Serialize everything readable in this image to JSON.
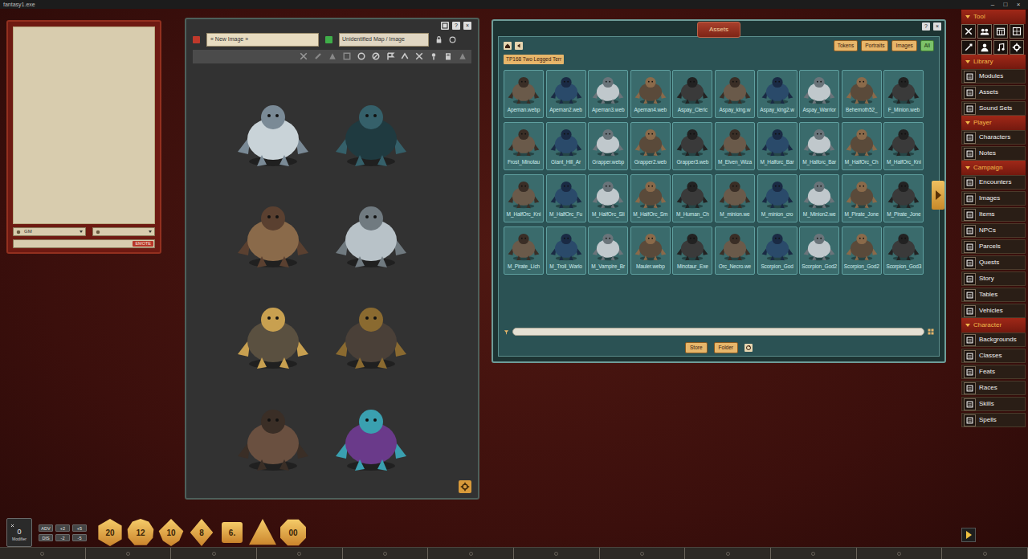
{
  "app": {
    "title": "fantasy1.exe",
    "controls": [
      "–",
      "□",
      "×"
    ]
  },
  "chat": {
    "speaker": "GM",
    "button": "EMOTE"
  },
  "image_window": {
    "name": "« New Image »",
    "type": "Unidentified Map / Image",
    "help": "?",
    "close": "×"
  },
  "assets": {
    "title": "Assets",
    "help": "?",
    "close": "×",
    "filters": [
      {
        "label": "Tokens",
        "selected": false
      },
      {
        "label": "Portraits",
        "selected": false
      },
      {
        "label": "Images",
        "selected": false
      },
      {
        "label": "All",
        "selected": true
      }
    ],
    "path": "TP168 Two Legged Terr",
    "items": [
      "Apeman.webp",
      "Apeman2.web",
      "Apeman3.web",
      "Apeman4.web",
      "Aspay_Cleric",
      "Aspay_king.w",
      "Aspay_king2.w",
      "Aspay_Warrior",
      "Behemoth52_",
      "F_Minion.web",
      "Frost_Minotau",
      "Giant_Hill_Ar",
      "Grapper.webp",
      "Grapper2.web",
      "Grapper3.web",
      "M_Elven_Wiza",
      "M_Halforc_Bar",
      "M_Halforc_Bar",
      "M_HalfOrc_Ch",
      "M_HalfOrc_Kni",
      "M_HalfOrc_Kni",
      "M_HalfOrc_Fu",
      "M_HalfOrc_Sli",
      "M_HalfOrc_Sm",
      "M_Human_Ch",
      "M_minion.we",
      "M_minion_cro",
      "M_Minion2.we",
      "M_Pirate_Jone",
      "M_Pirate_Jone",
      "M_Pirate_Lich",
      "M_Troll_Warlo",
      "M_Vampire_Br",
      "Mauler.webp",
      "Minotaur_Exe",
      "Orc_Necro.we",
      "Scorpion_God",
      "Scorpion_God2",
      "Scorpion_God2",
      "Scorpion_God3"
    ],
    "buttons": [
      "Store",
      "Folder"
    ]
  },
  "sidebar": {
    "sections": [
      {
        "label": "Tool",
        "expanded": true,
        "kind": "tools"
      },
      {
        "label": "Library",
        "expanded": true,
        "kind": "list",
        "items": [
          "Modules",
          "Assets",
          "Sound Sets"
        ]
      },
      {
        "label": "Player",
        "expanded": true,
        "kind": "list",
        "items": [
          "Characters",
          "Notes"
        ]
      },
      {
        "label": "Campaign",
        "expanded": true,
        "kind": "list",
        "items": [
          "Encounters",
          "Images",
          "Items",
          "NPCs",
          "Parcels",
          "Quests",
          "Story",
          "Tables",
          "Vehicles"
        ]
      },
      {
        "label": "Character",
        "expanded": true,
        "kind": "list",
        "items": [
          "Backgrounds",
          "Classes",
          "Feats",
          "Races",
          "Skills",
          "Spells"
        ]
      }
    ]
  },
  "dice_bar": {
    "modifier": {
      "value": "0",
      "label": "Modifier"
    },
    "buttons": [
      "ADV",
      "+2",
      "+5",
      "DIS",
      "-2",
      "-5"
    ],
    "dice": [
      {
        "kind": "d20",
        "label": "20"
      },
      {
        "kind": "d12",
        "label": "12"
      },
      {
        "kind": "d10",
        "label": "10"
      },
      {
        "kind": "d8",
        "label": "8"
      },
      {
        "kind": "d6",
        "label": "6."
      },
      {
        "kind": "d4"
      },
      {
        "kind": "d100",
        "label": "00"
      }
    ]
  }
}
